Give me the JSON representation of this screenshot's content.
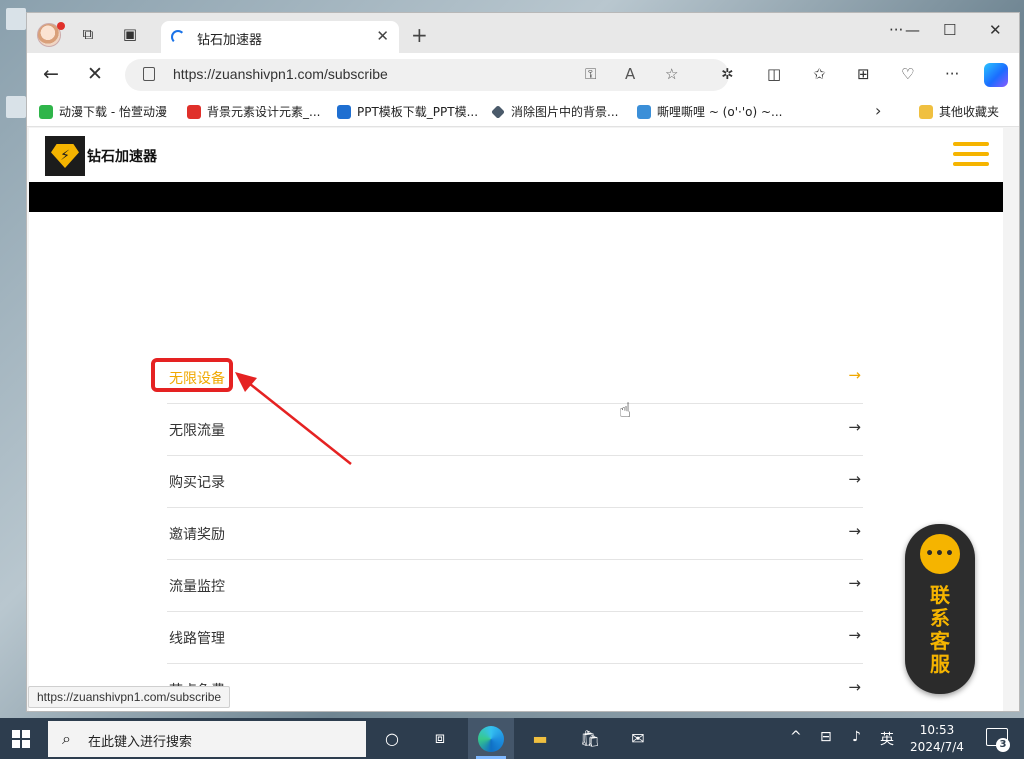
{
  "browser": {
    "tab_title": "钻石加速器",
    "url": "https://zuanshivpn1.com/subscribe",
    "status_url": "https://zuanshivpn1.com/subscribe"
  },
  "bookmarks": [
    {
      "label": "动漫下载 - 怡萱动漫",
      "color": "#2fb54a"
    },
    {
      "label": "背景元素设计元素_...",
      "color": "#e0302a"
    },
    {
      "label": "PPT模板下载_PPT模...",
      "color": "#1f6fd1"
    },
    {
      "label": "消除图片中的背景...",
      "color": "#4a5a6a"
    },
    {
      "label": "嘶哩嘶哩 ~ (o'·'o) ~...",
      "color": "#3b8fd8"
    }
  ],
  "other_bookmarks": "其他收藏夹",
  "site": {
    "brand": "钻石加速器",
    "accent": "#f5b400"
  },
  "menu": [
    {
      "label": "无限设备",
      "active": true
    },
    {
      "label": "无限流量",
      "active": false
    },
    {
      "label": "购买记录",
      "active": false
    },
    {
      "label": "邀请奖励",
      "active": false
    },
    {
      "label": "流量监控",
      "active": false
    },
    {
      "label": "线路管理",
      "active": false
    },
    {
      "label": "节点免费",
      "active": false
    }
  ],
  "customer_service": {
    "bubble": "•••",
    "label": "联系客服"
  },
  "taskbar": {
    "search_placeholder": "在此键入进行搜索",
    "ime": "英",
    "time": "10:53",
    "date": "2024/7/4",
    "notification_count": "3"
  },
  "icons": {
    "arrow": "→"
  }
}
